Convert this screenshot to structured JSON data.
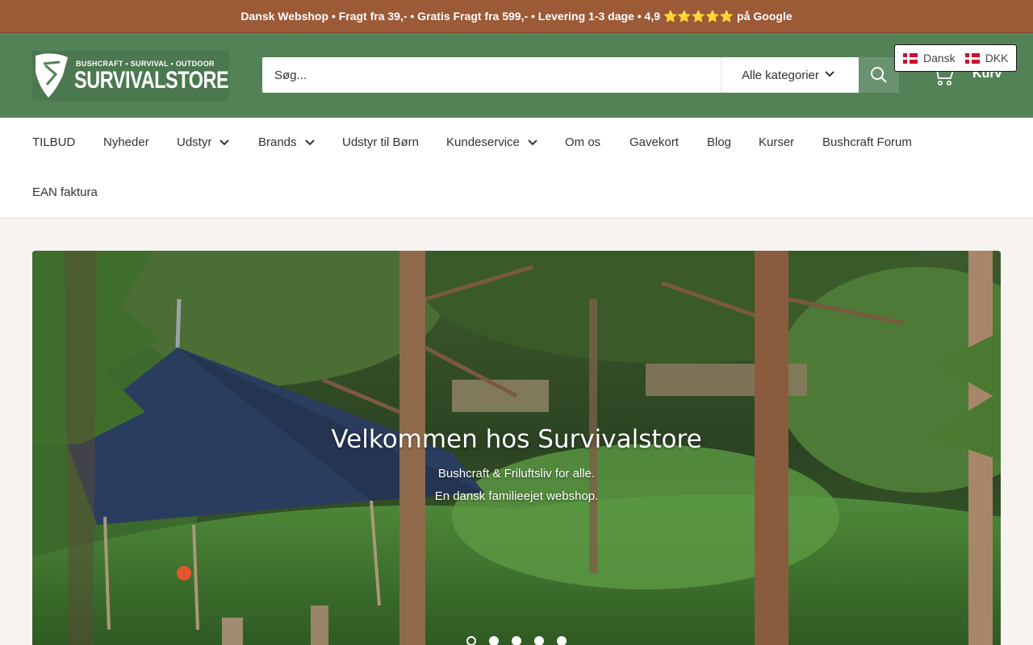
{
  "announcement": {
    "text_before": "Dansk Webshop • Fragt fra 39,- • Gratis Fragt fra 599,- • Levering 1-3 dage • 4,9",
    "stars": "⭐⭐⭐⭐⭐",
    "text_after": "på Google"
  },
  "logo": {
    "tagline": "BUSHCRAFT • SURVIVAL • OUTDOOR",
    "name": "SURVIVALSTORE"
  },
  "search": {
    "placeholder": "Søg...",
    "category_label": "Alle kategorier"
  },
  "cart": {
    "label": "Kurv"
  },
  "locale": {
    "language": "Dansk",
    "currency": "DKK"
  },
  "nav": {
    "items": [
      {
        "label": "TILBUD"
      },
      {
        "label": "Nyheder"
      },
      {
        "label": "Udstyr"
      },
      {
        "label": "Brands"
      },
      {
        "label": "Udstyr til Børn"
      },
      {
        "label": "Kundeservice"
      },
      {
        "label": "Om os"
      },
      {
        "label": "Gavekort"
      },
      {
        "label": "Blog"
      },
      {
        "label": "Kurser"
      },
      {
        "label": "Bushcraft Forum"
      },
      {
        "label": "EAN faktura"
      }
    ]
  },
  "hero": {
    "title": "Velkommen hos Survivalstore",
    "line1": "Bushcraft & Friluftsliv for alle.",
    "line2": "En dansk familieejet webshop.",
    "slide_count": 5,
    "active_slide": 1
  },
  "colors": {
    "announcement_bg": "#9c5a37",
    "header_bg": "#548257",
    "star": "#f7c331"
  }
}
